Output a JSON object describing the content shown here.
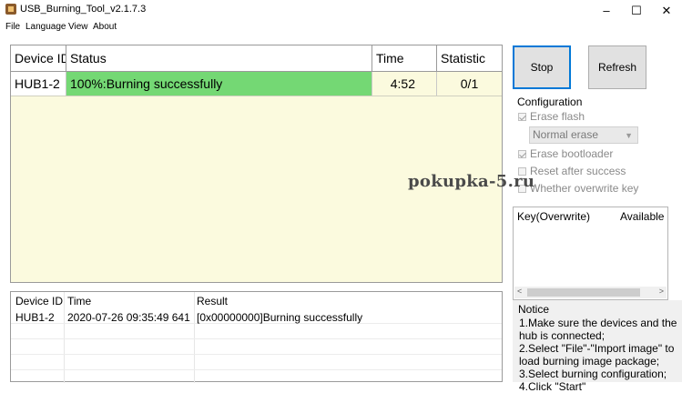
{
  "window": {
    "title": "USB_Burning_Tool_v2.1.7.3",
    "controls": {
      "minimize": "–",
      "maximize": "☐",
      "close": "✕"
    }
  },
  "menu": {
    "items": [
      "File",
      "Language",
      "View",
      "About"
    ]
  },
  "device_table": {
    "columns": [
      "Device ID",
      "Status",
      "Time",
      "Statistic"
    ],
    "rows": [
      {
        "device_id": "HUB1-2",
        "status": "100%:Burning successfully",
        "time": "4:52",
        "statistic": "0/1"
      }
    ],
    "status_color": "#74d874",
    "background": "#fbfade"
  },
  "log_table": {
    "columns": [
      "Device ID",
      "Time",
      "Result"
    ],
    "rows": [
      {
        "device_id": "HUB1-2",
        "time": "2020-07-26 09:35:49 641",
        "result": "[0x00000000]Burning successfully"
      }
    ]
  },
  "buttons": {
    "stop": "Stop",
    "refresh": "Refresh"
  },
  "configuration": {
    "title": "Configuration",
    "erase_flash": {
      "label": "Erase flash",
      "checked": true,
      "enabled": false
    },
    "erase_mode": {
      "selected": "Normal erase",
      "enabled": false
    },
    "erase_bootloader": {
      "label": "Erase bootloader",
      "checked": true,
      "enabled": false
    },
    "reset_after_success": {
      "label": "Reset after success",
      "checked": false,
      "enabled": false
    },
    "overwrite_key": {
      "label": "Whether overwrite key",
      "checked": false,
      "enabled": false
    }
  },
  "watermark": "pokupka-5.ru",
  "key_table": {
    "columns": [
      "Key(Overwrite)",
      "Available"
    ]
  },
  "notice": {
    "title": "Notice",
    "lines": [
      "1.Make sure the devices and the",
      "hub is connected;",
      "2.Select \"File\"-\"Import image\" to",
      "load burning image package;",
      "3.Select burning configuration;",
      "4.Click \"Start\""
    ]
  },
  "colors": {
    "accent": "#0078d7",
    "success": "#74d874"
  }
}
